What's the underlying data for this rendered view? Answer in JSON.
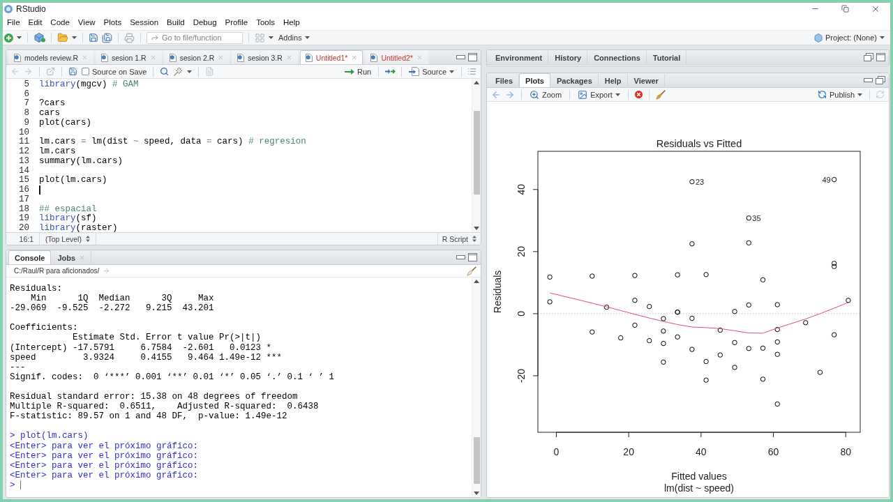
{
  "window": {
    "title": "RStudio"
  },
  "menu": [
    "File",
    "Edit",
    "Code",
    "View",
    "Plots",
    "Session",
    "Build",
    "Debug",
    "Profile",
    "Tools",
    "Help"
  ],
  "toolbar": {
    "go_to": {
      "placeholder": "Go to file/function"
    },
    "addins": "Addins",
    "project": "Project: (None)"
  },
  "editor": {
    "tabs": [
      {
        "label": "models review.R",
        "selected": false,
        "modified": false
      },
      {
        "label": "sesion 1.R",
        "selected": false,
        "modified": false
      },
      {
        "label": "sesion 2.R",
        "selected": false,
        "modified": false
      },
      {
        "label": "sesion 3.R",
        "selected": false,
        "modified": false
      },
      {
        "label": "Untitled1*",
        "selected": true,
        "modified": true
      },
      {
        "label": "Untitled2*",
        "selected": false,
        "modified": true
      }
    ],
    "toolbar": {
      "source_on_save": {
        "label": "Source on Save",
        "checked": false
      },
      "run": "Run",
      "source": "Source"
    },
    "lines": [
      {
        "number": "5",
        "cursor": false,
        "tokens": [
          {
            "kind": "keyword",
            "text": "library"
          },
          {
            "kind": "plain",
            "text": "(mgcv) "
          },
          {
            "kind": "comment",
            "text": "# GAM"
          }
        ]
      },
      {
        "number": "6",
        "cursor": false
      },
      {
        "number": "7",
        "cursor": false,
        "tokens": [
          {
            "kind": "plain",
            "text": "?cars"
          }
        ]
      },
      {
        "number": "8",
        "cursor": false,
        "tokens": [
          {
            "kind": "plain",
            "text": "cars"
          }
        ]
      },
      {
        "number": "9",
        "cursor": false,
        "tokens": [
          {
            "kind": "plain",
            "text": "plot(cars)"
          }
        ]
      },
      {
        "number": "10",
        "cursor": false
      },
      {
        "number": "11",
        "cursor": false,
        "tokens": [
          {
            "kind": "plain",
            "text": "lm.cars "
          },
          {
            "kind": "operator",
            "text": "="
          },
          {
            "kind": "plain",
            "text": " lm(dist "
          },
          {
            "kind": "operator",
            "text": "~"
          },
          {
            "kind": "plain",
            "text": " speed, data "
          },
          {
            "kind": "operator",
            "text": "="
          },
          {
            "kind": "plain",
            "text": " cars) "
          },
          {
            "kind": "comment",
            "text": "# regresion"
          }
        ]
      },
      {
        "number": "12",
        "cursor": false,
        "tokens": [
          {
            "kind": "plain",
            "text": "lm.cars"
          }
        ]
      },
      {
        "number": "13",
        "cursor": false,
        "tokens": [
          {
            "kind": "plain",
            "text": "summary(lm.cars)"
          }
        ]
      },
      {
        "number": "14",
        "cursor": false
      },
      {
        "number": "15",
        "cursor": false,
        "tokens": [
          {
            "kind": "plain",
            "text": "plot(lm.cars)"
          }
        ]
      },
      {
        "number": "16",
        "cursor": true
      },
      {
        "number": "17",
        "cursor": false
      },
      {
        "number": "18",
        "cursor": false,
        "tokens": [
          {
            "kind": "comment",
            "text": "## espacial"
          }
        ]
      },
      {
        "number": "19",
        "cursor": false,
        "tokens": [
          {
            "kind": "keyword",
            "text": "library"
          },
          {
            "kind": "plain",
            "text": "(sf)"
          }
        ]
      },
      {
        "number": "20",
        "cursor": false,
        "tokens": [
          {
            "kind": "keyword",
            "text": "library"
          },
          {
            "kind": "plain",
            "text": "(raster)"
          }
        ]
      }
    ],
    "status": {
      "position": "16:1",
      "scope": "(Top Level)",
      "file_type": "R Script"
    }
  },
  "console": {
    "tabs": [
      {
        "label": "Console",
        "selected": true,
        "closable": false
      },
      {
        "label": "Jobs",
        "selected": false,
        "closable": true
      }
    ],
    "path": "C:/Raul/R para aficionados/",
    "blocks": [
      {
        "lines": [
          {
            "kind": "output",
            "text": "Residuals:"
          },
          {
            "kind": "output",
            "text": "    Min      1Q  Median      3Q     Max"
          },
          {
            "kind": "output",
            "text": "-29.069  -9.525  -2.272   9.215  43.201"
          }
        ]
      },
      {
        "lines": [
          {
            "kind": "output",
            "text": "Coefficients:"
          },
          {
            "kind": "output",
            "text": "            Estimate Std. Error t value Pr(>|t|)"
          },
          {
            "kind": "output",
            "text": "(Intercept) -17.5791     6.7584  -2.601   0.0123 *"
          },
          {
            "kind": "output",
            "text": "speed         3.9324     0.4155   9.464 1.49e-12 ***"
          },
          {
            "kind": "output",
            "text": "---"
          },
          {
            "kind": "output",
            "text": "Signif. codes:  0 ‘***’ 0.001 ‘**’ 0.01 ‘*’ 0.05 ‘.’ 0.1 ‘ ’ 1"
          }
        ]
      },
      {
        "lines": [
          {
            "kind": "output",
            "text": "Residual standard error: 15.38 on 48 degrees of freedom"
          },
          {
            "kind": "output",
            "text": "Multiple R-squared:  0.6511,    Adjusted R-squared:  0.6438"
          },
          {
            "kind": "output",
            "text": "F-statistic: 89.57 on 1 and 48 DF,  p-value: 1.49e-12"
          }
        ]
      },
      {
        "lines": [
          {
            "kind": "input",
            "text": "> plot(lm.cars)"
          },
          {
            "kind": "input",
            "text": "<Enter> para ver el próximo gráfico:"
          },
          {
            "kind": "input",
            "text": "<Enter> para ver el próximo gráfico:"
          },
          {
            "kind": "input",
            "text": "<Enter> para ver el próximo gráfico:"
          },
          {
            "kind": "input",
            "text": "<Enter> para ver el próximo gráfico:"
          }
        ]
      }
    ],
    "prompt": {
      "text": ">",
      "cursor": true
    }
  },
  "environment_pane": {
    "tabs": [
      {
        "label": "Environment",
        "selected": false
      },
      {
        "label": "History",
        "selected": false
      },
      {
        "label": "Connections",
        "selected": false
      },
      {
        "label": "Tutorial",
        "selected": false
      }
    ]
  },
  "files_pane": {
    "tabs": [
      {
        "label": "Files",
        "selected": false
      },
      {
        "label": "Plots",
        "selected": true
      },
      {
        "label": "Packages",
        "selected": false
      },
      {
        "label": "Help",
        "selected": false
      },
      {
        "label": "Viewer",
        "selected": false
      }
    ],
    "toolbar": {
      "zoom": "Zoom",
      "export": "Export",
      "publish": "Publish"
    },
    "plot": {
      "chart_data": {
        "type": "scatter",
        "title": "Residuals vs Fitted",
        "xlabel": "Fitted values",
        "subtitle": "lm(dist ~ speed)",
        "ylabel": "Residuals",
        "x": [
          -1.8,
          -1.8,
          9.9,
          9.9,
          13.9,
          17.8,
          21.7,
          21.7,
          21.7,
          25.7,
          25.7,
          29.6,
          29.6,
          29.6,
          29.6,
          33.5,
          33.5,
          33.5,
          33.5,
          37.5,
          37.5,
          37.5,
          37.5,
          41.4,
          41.4,
          41.4,
          45.3,
          45.3,
          49.3,
          49.3,
          49.3,
          53.2,
          53.2,
          53.2,
          53.2,
          57.1,
          57.1,
          57.1,
          61.1,
          61.1,
          61.1,
          61.1,
          61.1,
          68.9,
          72.9,
          76.8,
          76.8,
          76.8,
          76.8,
          80.7
        ],
        "series": [
          {
            "color": "#000000",
            "values": [
              3.8,
              11.8,
              -5.9,
              12.1,
              2.1,
              -7.8,
              -3.7,
              4.3,
              12.3,
              -8.7,
              2.3,
              -15.6,
              -9.6,
              -5.6,
              -1.6,
              -7.5,
              0.5,
              0.5,
              12.5,
              -11.5,
              -1.5,
              22.5,
              42.5,
              -21.4,
              -15.4,
              12.6,
              -13.3,
              -5.3,
              -17.3,
              -9.3,
              0.7,
              -11.2,
              2.8,
              22.8,
              30.8,
              -21.1,
              -11.1,
              10.9,
              -29.1,
              -13.1,
              -9.1,
              -5.1,
              2.9,
              -2.9,
              -18.9,
              -6.8,
              15.2,
              16.2,
              43.2,
              4.3
            ]
          },
          {
            "type": "line",
            "color": "#df536b",
            "values": [
              6.7,
              6.7,
              3.4,
              3.4,
              2.2,
              1.0,
              -0.2,
              -0.2,
              -0.2,
              -1.4,
              -1.4,
              -2.5,
              -2.5,
              -2.5,
              -2.5,
              -3.5,
              -3.5,
              -3.5,
              -3.5,
              -4.3,
              -4.3,
              -4.3,
              -4.3,
              -4.5,
              -4.5,
              -4.5,
              -4.8,
              -4.8,
              -5.5,
              -5.5,
              -5.5,
              -6.2,
              -6.2,
              -6.2,
              -6.2,
              -6.3,
              -6.3,
              -6.3,
              -4.6,
              -4.6,
              -4.6,
              -4.6,
              -4.6,
              -1.7,
              0.0,
              1.8,
              1.8,
              1.8,
              1.8,
              3.6
            ]
          }
        ],
        "xlim": [
          -5.1,
          84.0
        ],
        "ylim": [
          -38.2,
          52.3
        ],
        "xticks": [
          0,
          20,
          40,
          60,
          80
        ],
        "yticks": [
          -20,
          0,
          20,
          40
        ],
        "ref_lines": [
          {
            "axis": "y",
            "value": 0
          }
        ],
        "annotations": [
          {
            "x": 37.5,
            "y": 42.5,
            "text": "23"
          },
          {
            "x": 53.2,
            "y": 30.8,
            "text": "35"
          },
          {
            "x": 76.8,
            "y": 43.2,
            "text": "49"
          }
        ]
      }
    }
  }
}
